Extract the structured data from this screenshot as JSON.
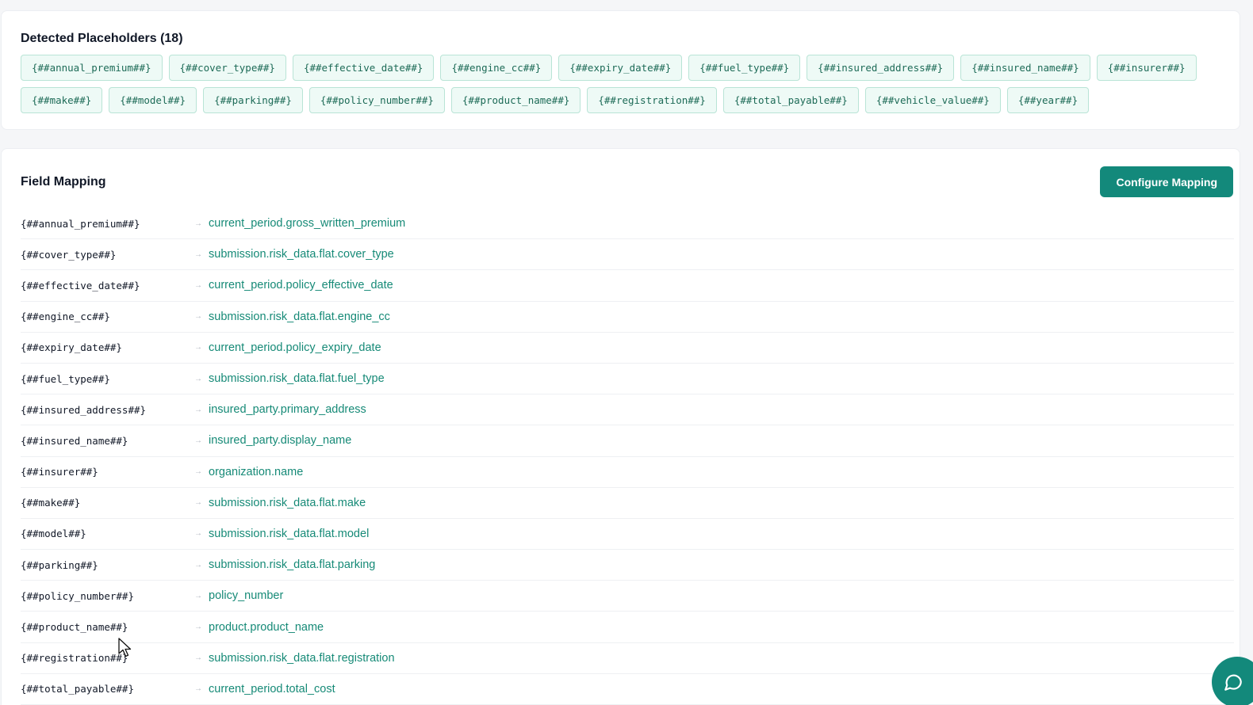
{
  "placeholders": {
    "title": "Detected Placeholders (18)",
    "chips": [
      "{##annual_premium##}",
      "{##cover_type##}",
      "{##effective_date##}",
      "{##engine_cc##}",
      "{##expiry_date##}",
      "{##fuel_type##}",
      "{##insured_address##}",
      "{##insured_name##}",
      "{##insurer##}",
      "{##make##}",
      "{##model##}",
      "{##parking##}",
      "{##policy_number##}",
      "{##product_name##}",
      "{##registration##}",
      "{##total_payable##}",
      "{##vehicle_value##}",
      "{##year##}"
    ]
  },
  "mapping": {
    "title": "Field Mapping",
    "configure_label": "Configure Mapping",
    "arrow": "→",
    "rows": [
      {
        "key": "{##annual_premium##}",
        "value": "current_period.gross_written_premium"
      },
      {
        "key": "{##cover_type##}",
        "value": "submission.risk_data.flat.cover_type"
      },
      {
        "key": "{##effective_date##}",
        "value": "current_period.policy_effective_date"
      },
      {
        "key": "{##engine_cc##}",
        "value": "submission.risk_data.flat.engine_cc"
      },
      {
        "key": "{##expiry_date##}",
        "value": "current_period.policy_expiry_date"
      },
      {
        "key": "{##fuel_type##}",
        "value": "submission.risk_data.flat.fuel_type"
      },
      {
        "key": "{##insured_address##}",
        "value": "insured_party.primary_address"
      },
      {
        "key": "{##insured_name##}",
        "value": "insured_party.display_name"
      },
      {
        "key": "{##insurer##}",
        "value": "organization.name"
      },
      {
        "key": "{##make##}",
        "value": "submission.risk_data.flat.make"
      },
      {
        "key": "{##model##}",
        "value": "submission.risk_data.flat.model"
      },
      {
        "key": "{##parking##}",
        "value": "submission.risk_data.flat.parking"
      },
      {
        "key": "{##policy_number##}",
        "value": "policy_number"
      },
      {
        "key": "{##product_name##}",
        "value": "product.product_name"
      },
      {
        "key": "{##registration##}",
        "value": "submission.risk_data.flat.registration"
      },
      {
        "key": "{##total_payable##}",
        "value": "current_period.total_cost"
      }
    ]
  },
  "icons": {
    "chat": "chat-bubble-icon",
    "cursor": "mouse-pointer-icon"
  },
  "colors": {
    "accent": "#13897b",
    "chip_bg": "#eefaf6",
    "chip_border": "#b9e4d6",
    "mapped_value": "#168a77"
  }
}
